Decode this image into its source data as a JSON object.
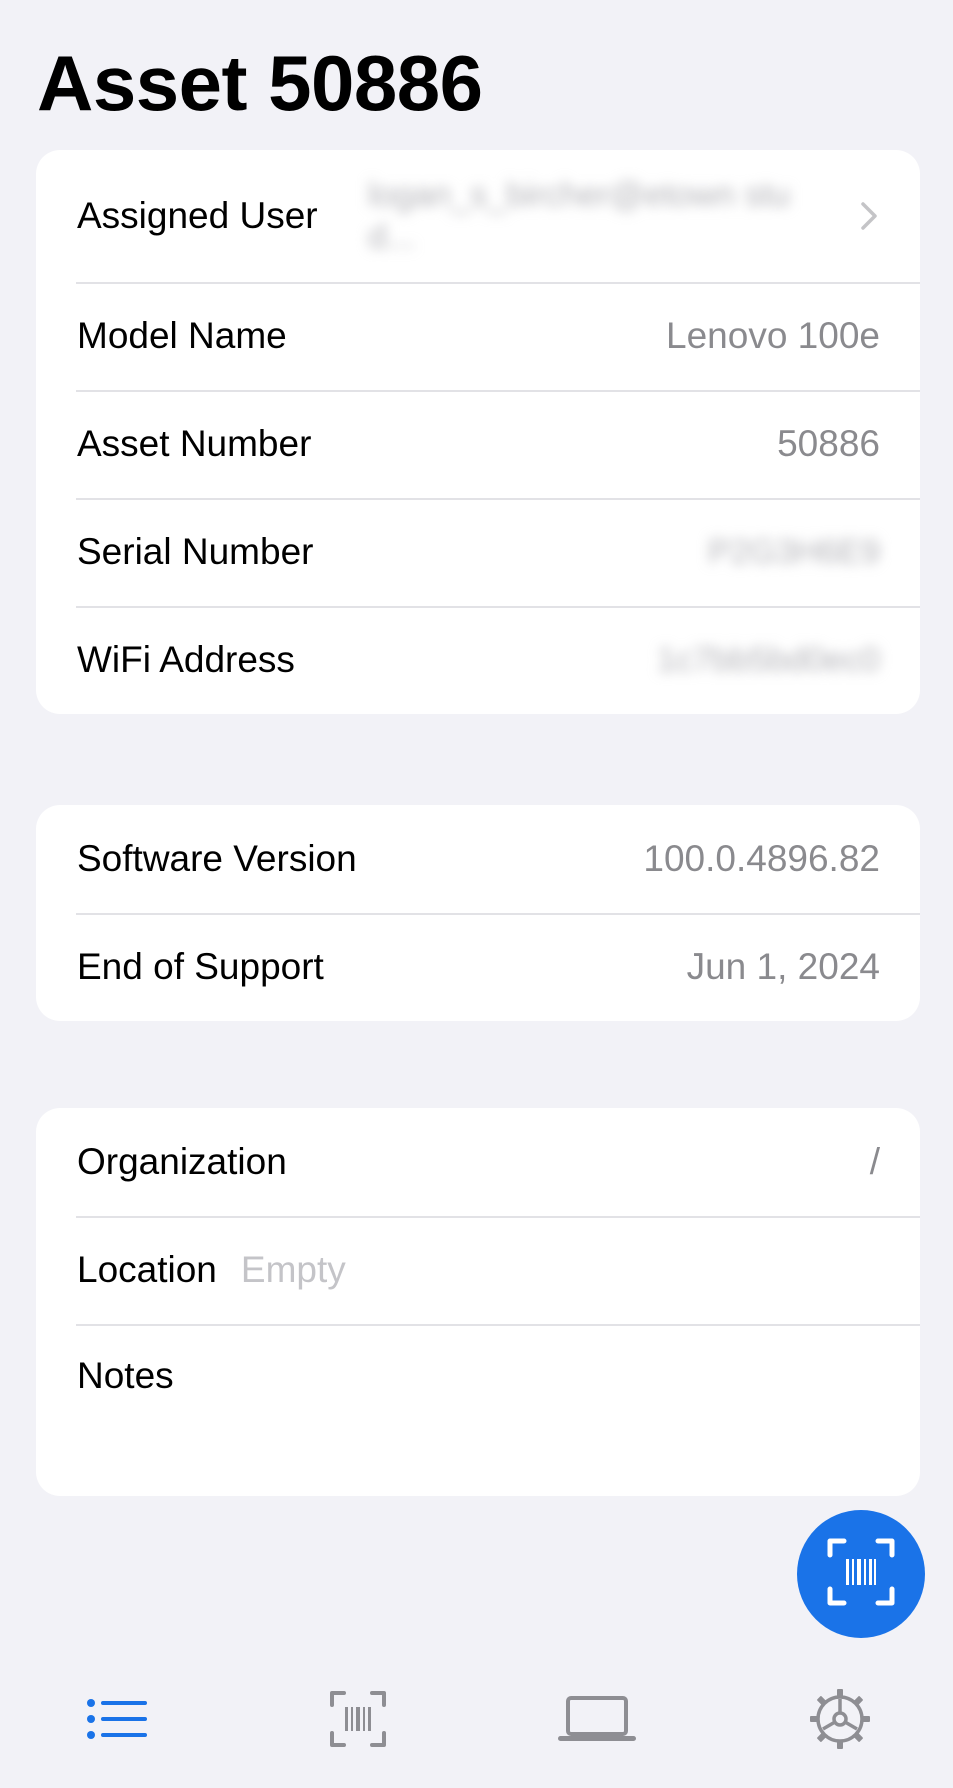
{
  "header": {
    "title": "Asset 50886"
  },
  "device_info": {
    "assigned_user": {
      "label": "Assigned User",
      "value": "logan_s_bircher@etown stud..."
    },
    "model_name": {
      "label": "Model Name",
      "value": "Lenovo 100e"
    },
    "asset_number": {
      "label": "Asset Number",
      "value": "50886"
    },
    "serial_number": {
      "label": "Serial Number",
      "value": "P2G3H6E9"
    },
    "wifi_address": {
      "label": "WiFi Address",
      "value": "1c7bb5bd0ec0"
    }
  },
  "software": {
    "version": {
      "label": "Software Version",
      "value": "100.0.4896.82"
    },
    "end_of_support": {
      "label": "End of Support",
      "value": "Jun 1, 2024"
    }
  },
  "organization_section": {
    "organization": {
      "label": "Organization",
      "value": "/"
    },
    "location": {
      "label": "Location",
      "placeholder": "Empty"
    },
    "notes": {
      "label": "Notes"
    }
  },
  "fab": {
    "icon": "barcode-scan-icon",
    "color": "#1a73e8"
  },
  "tabbar": {
    "tabs": [
      {
        "icon": "list-icon",
        "active": true
      },
      {
        "icon": "barcode-scan-icon",
        "active": false
      },
      {
        "icon": "laptop-icon",
        "active": false
      },
      {
        "icon": "gear-icon",
        "active": false
      }
    ],
    "active_color": "#1a73e8",
    "inactive_color": "#8e8e93"
  }
}
